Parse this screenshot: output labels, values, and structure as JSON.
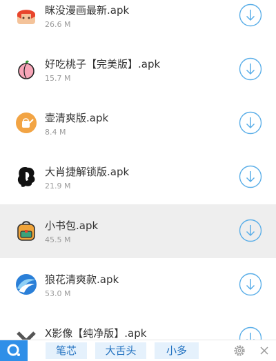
{
  "files": [
    {
      "icon": "manga-app-icon",
      "name": "眯没漫画最新.apk",
      "size": "26.6 M"
    },
    {
      "icon": "peach-icon",
      "name": "好吃桃子【完美版】.apk",
      "size": "15.7 M"
    },
    {
      "icon": "watering-can-icon",
      "name": "壶清爽版.apk",
      "size": "8.4 M"
    },
    {
      "icon": "woman-silhouette-icon",
      "name": "大肖捷解锁版.apk",
      "size": "21.9 M"
    },
    {
      "icon": "backpack-icon",
      "name": "小书包.apk",
      "size": "45.5 M"
    },
    {
      "icon": "wave-icon",
      "name": "狼花清爽款.apk",
      "size": "53.0 M"
    },
    {
      "icon": "x-video-icon",
      "name": "X影像【纯净版】.apk",
      "size": ""
    }
  ],
  "bottom_bar": {
    "tags": [
      "笔芯",
      "大舌头",
      "小多"
    ],
    "logo_icon": "search-logo-icon",
    "settings_icon": "gear-icon",
    "close_icon": "close-icon"
  },
  "colors": {
    "accent": "#2f8fe8",
    "download_ring": "#5aaee8",
    "highlight_row": "#eeeeee",
    "tag_bg": "#e5f1fc",
    "tag_text": "#1e6fbf"
  }
}
